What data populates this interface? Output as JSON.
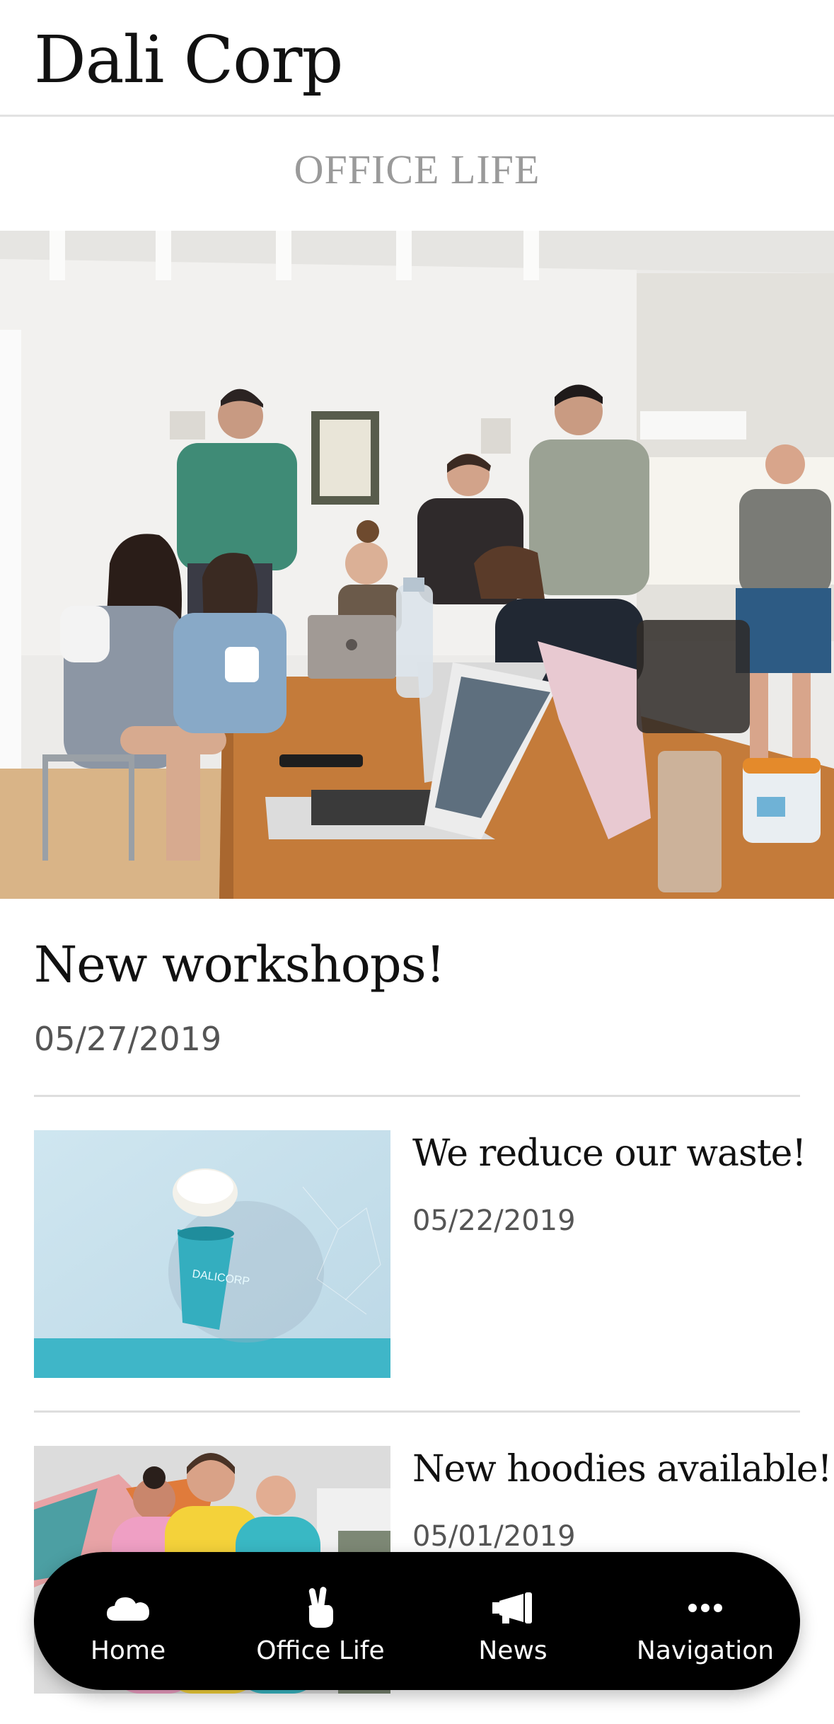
{
  "header": {
    "title": "Dali Corp"
  },
  "section": {
    "title": "OFFICE LIFE"
  },
  "featured": {
    "title": "New workshops!",
    "date": "05/27/2019"
  },
  "articles": [
    {
      "title": "We reduce our waste!",
      "date": "05/22/2019",
      "thumb_text": "DALICORP"
    },
    {
      "title": "New hoodies available!",
      "date": "05/01/2019"
    }
  ],
  "tabbar": {
    "items": [
      {
        "label": "Home",
        "icon": "cloud-icon"
      },
      {
        "label": "Office Life",
        "icon": "peace-hand-icon"
      },
      {
        "label": "News",
        "icon": "megaphone-icon"
      },
      {
        "label": "Navigation",
        "icon": "more-dots-icon"
      }
    ]
  },
  "colors": {
    "background": "#ffffff",
    "text": "#111111",
    "muted": "#9a9a9a",
    "date": "#555555",
    "tabbar": "#000000",
    "tabbar_text": "#ffffff"
  }
}
